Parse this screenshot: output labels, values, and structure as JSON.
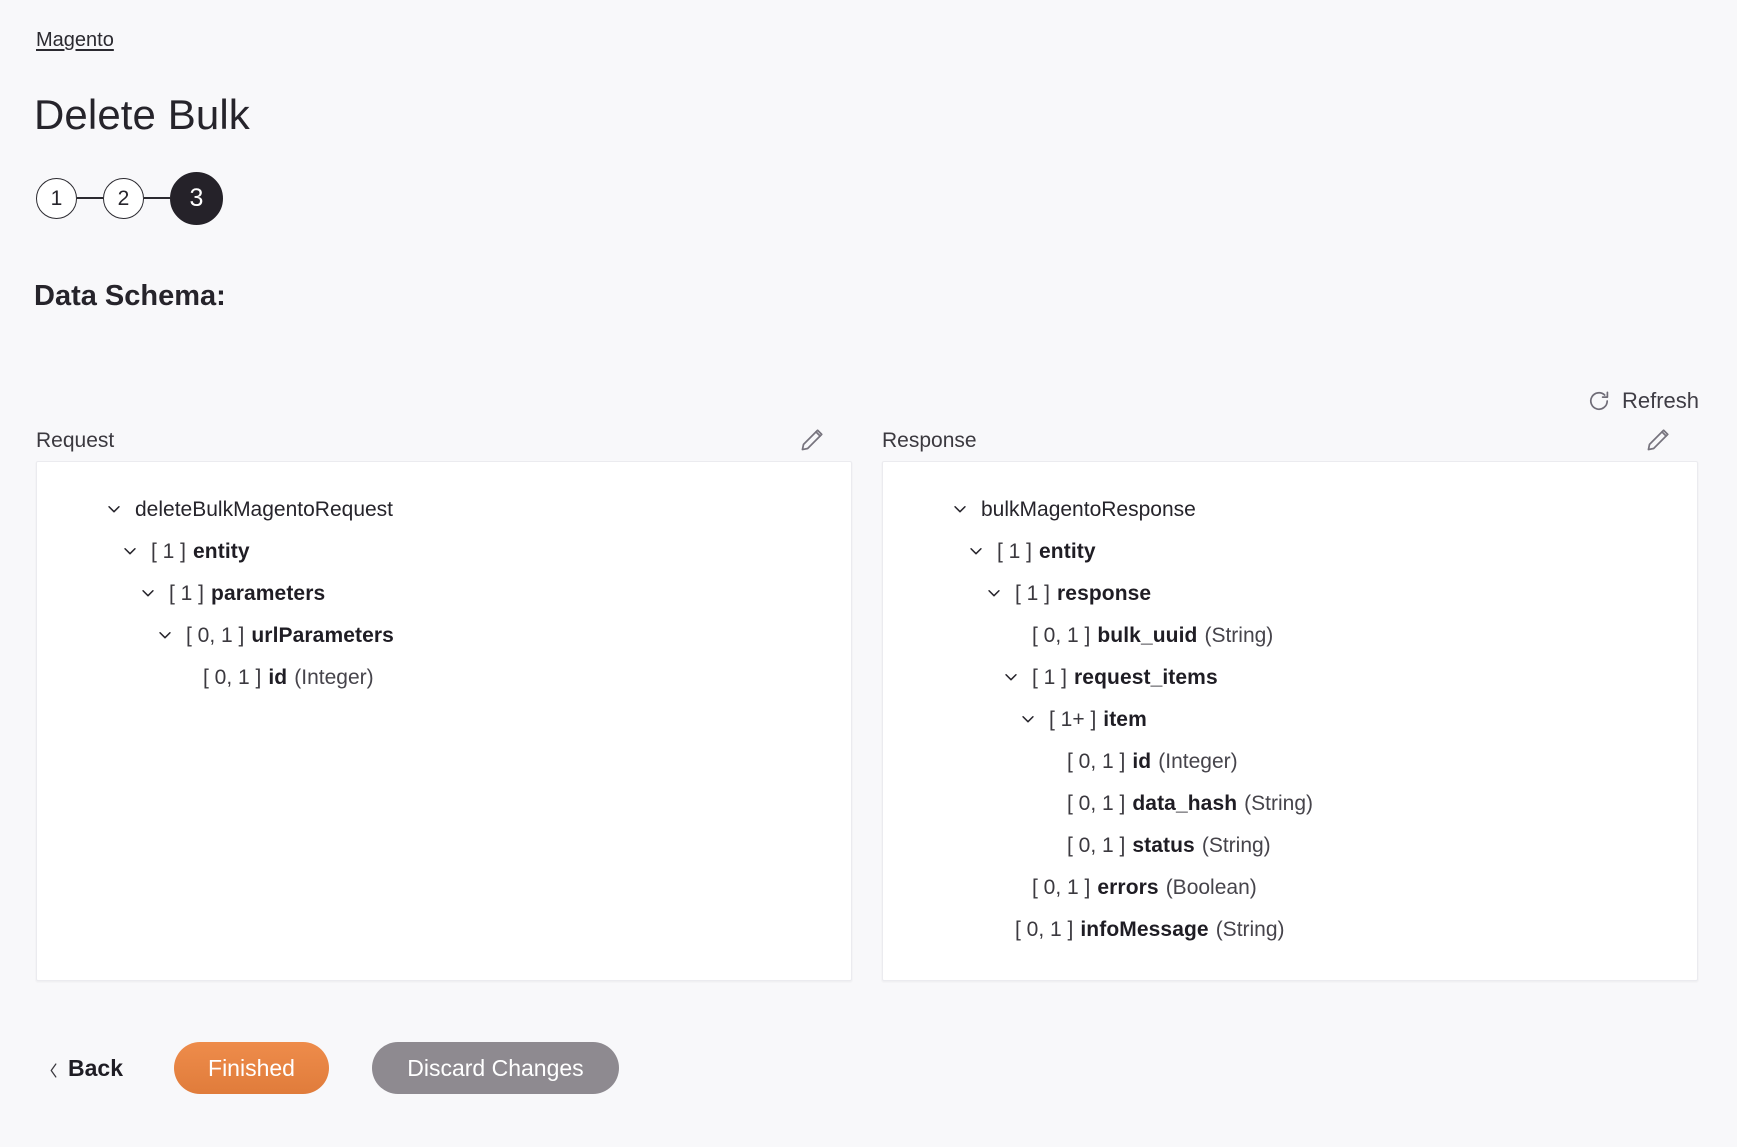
{
  "breadcrumb": {
    "label": "Magento"
  },
  "header": {
    "title": "Delete Bulk"
  },
  "stepper": {
    "steps": [
      {
        "label": "1",
        "active": false
      },
      {
        "label": "2",
        "active": false
      },
      {
        "label": "3",
        "active": true
      }
    ]
  },
  "section": {
    "heading": "Data Schema:"
  },
  "toolbar": {
    "refresh_label": "Refresh",
    "refresh_icon": "refresh-icon",
    "edit_icon": "pencil-icon"
  },
  "colors": {
    "page_background": "#f8f8fa",
    "panel_background": "#ffffff",
    "accent_primary": "#e07c3b",
    "accent_secondary": "#8e8a90",
    "step_active": "#252229",
    "text": "#26242b"
  },
  "request": {
    "label": "Request",
    "nodes": [
      {
        "level": 0,
        "chevron": true,
        "cardinality": "",
        "name": "deleteBulkMagentoRequest",
        "type": "",
        "root": true
      },
      {
        "level": 1,
        "chevron": true,
        "cardinality": "[ 1 ]",
        "name": "entity",
        "type": ""
      },
      {
        "level": 2,
        "chevron": true,
        "cardinality": "[ 1 ]",
        "name": "parameters",
        "type": ""
      },
      {
        "level": 3,
        "chevron": true,
        "cardinality": "[ 0, 1 ]",
        "name": "urlParameters",
        "type": ""
      },
      {
        "level": 4,
        "chevron": false,
        "cardinality": "[ 0, 1 ]",
        "name": "id",
        "type": "(Integer)"
      }
    ]
  },
  "response": {
    "label": "Response",
    "nodes": [
      {
        "level": 0,
        "chevron": true,
        "cardinality": "",
        "name": "bulkMagentoResponse",
        "type": "",
        "root": true
      },
      {
        "level": 1,
        "chevron": true,
        "cardinality": "[ 1 ]",
        "name": "entity",
        "type": ""
      },
      {
        "level": 2,
        "chevron": true,
        "cardinality": "[ 1 ]",
        "name": "response",
        "type": ""
      },
      {
        "level": 3,
        "chevron": false,
        "cardinality": "[ 0, 1 ]",
        "name": "bulk_uuid",
        "type": "(String)"
      },
      {
        "level": 3,
        "chevron": true,
        "cardinality": "[ 1 ]",
        "name": "request_items",
        "type": ""
      },
      {
        "level": 4,
        "chevron": true,
        "cardinality": "[ 1+ ]",
        "name": "item",
        "type": ""
      },
      {
        "level": 5,
        "chevron": false,
        "cardinality": "[ 0, 1 ]",
        "name": "id",
        "type": "(Integer)"
      },
      {
        "level": 5,
        "chevron": false,
        "cardinality": "[ 0, 1 ]",
        "name": "data_hash",
        "type": "(String)"
      },
      {
        "level": 5,
        "chevron": false,
        "cardinality": "[ 0, 1 ]",
        "name": "status",
        "type": "(String)"
      },
      {
        "level": 3,
        "chevron": false,
        "cardinality": "[ 0, 1 ]",
        "name": "errors",
        "type": "(Boolean)"
      },
      {
        "level": 2,
        "chevron": false,
        "cardinality": "[ 0, 1 ]",
        "name": "infoMessage",
        "type": "(String)"
      }
    ]
  },
  "footer": {
    "back_label": "Back",
    "finished_label": "Finished",
    "discard_label": "Discard Changes"
  }
}
